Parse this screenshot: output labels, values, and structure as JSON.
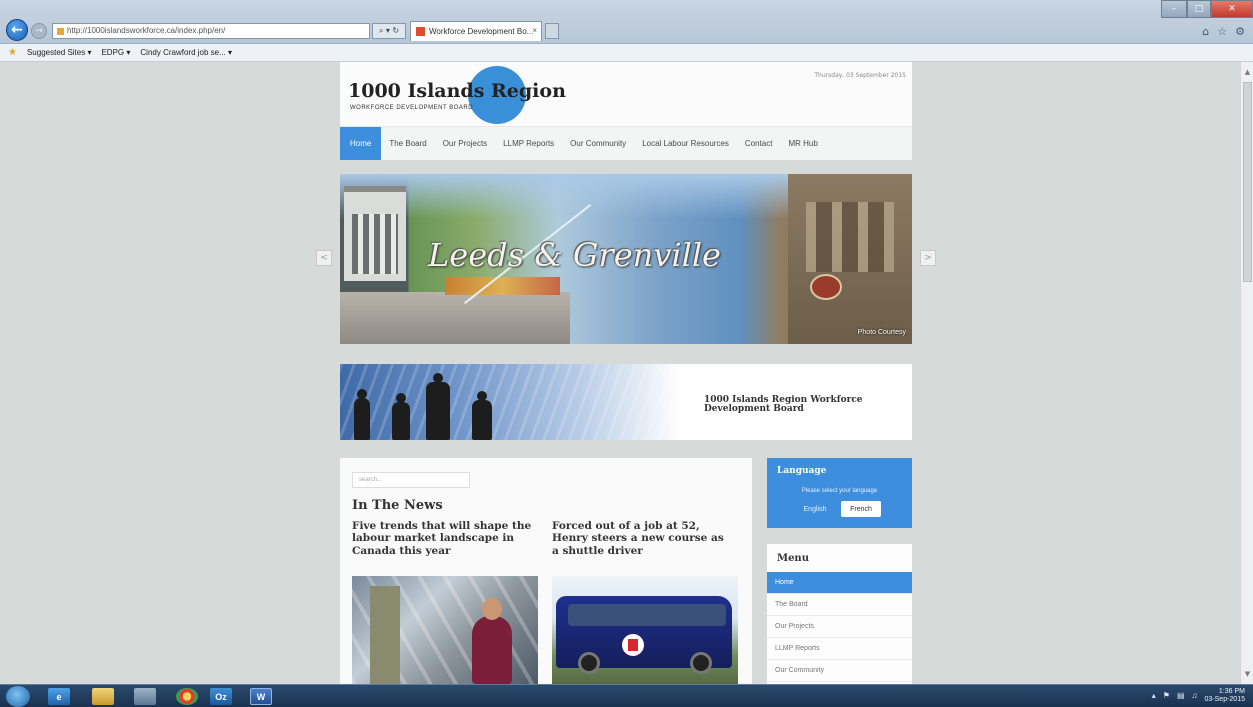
{
  "browser": {
    "address": "http://1000islandsworkforce.ca/index.php/en/",
    "tab_title": "Workforce Development Bo...",
    "tab_close": "×",
    "favorites": {
      "suggested_sites": "Suggested Sites ▾",
      "item2": "EDPG ▾",
      "item3": "Cindy Crawford job se... ▾"
    },
    "icons": [
      "back-arrow-icon",
      "forward-arrow-icon",
      "home-icon",
      "star-icon",
      "gear-icon"
    ]
  },
  "site": {
    "logo_title": "1000 Islands Region",
    "logo_subtitle": "WORKFORCE DEVELOPMENT BOARD",
    "date": "Thursday, 03 September 2015",
    "nav": [
      "Home",
      "The Board",
      "Our Projects",
      "LLMP Reports",
      "Our Community",
      "Local Labour Resources",
      "Contact",
      "MR Hub"
    ],
    "slider": {
      "caption": "Leeds & Grenville",
      "credit": "Photo Courtesy",
      "prev": "<",
      "next": ">"
    },
    "banner_text": "1000 Islands Region Workforce Development Board",
    "search_placeholder": "search...",
    "news_heading": "In The News",
    "news": [
      {
        "title": "Five trends that will shape the labour market landscape in Canada this year"
      },
      {
        "title": "Forced out of a job at 52, Henry steers a new course as a shuttle driver"
      }
    ],
    "language": {
      "title": "Language",
      "desc": "Please select your language",
      "english": "English",
      "french": "French"
    },
    "menu": {
      "title": "Menu",
      "items": [
        "Home",
        "The Board",
        "Our Projects",
        "LLMP Reports",
        "Our Community"
      ]
    }
  },
  "taskbar": {
    "time": "1:36 PM",
    "date": "03-Sep-2015",
    "outlook_label": "Oz",
    "word_label": "W"
  },
  "colors": {
    "accent": "#3d8fde",
    "page_bg": "#d6dbd9",
    "taskbar": "#1b3250"
  }
}
